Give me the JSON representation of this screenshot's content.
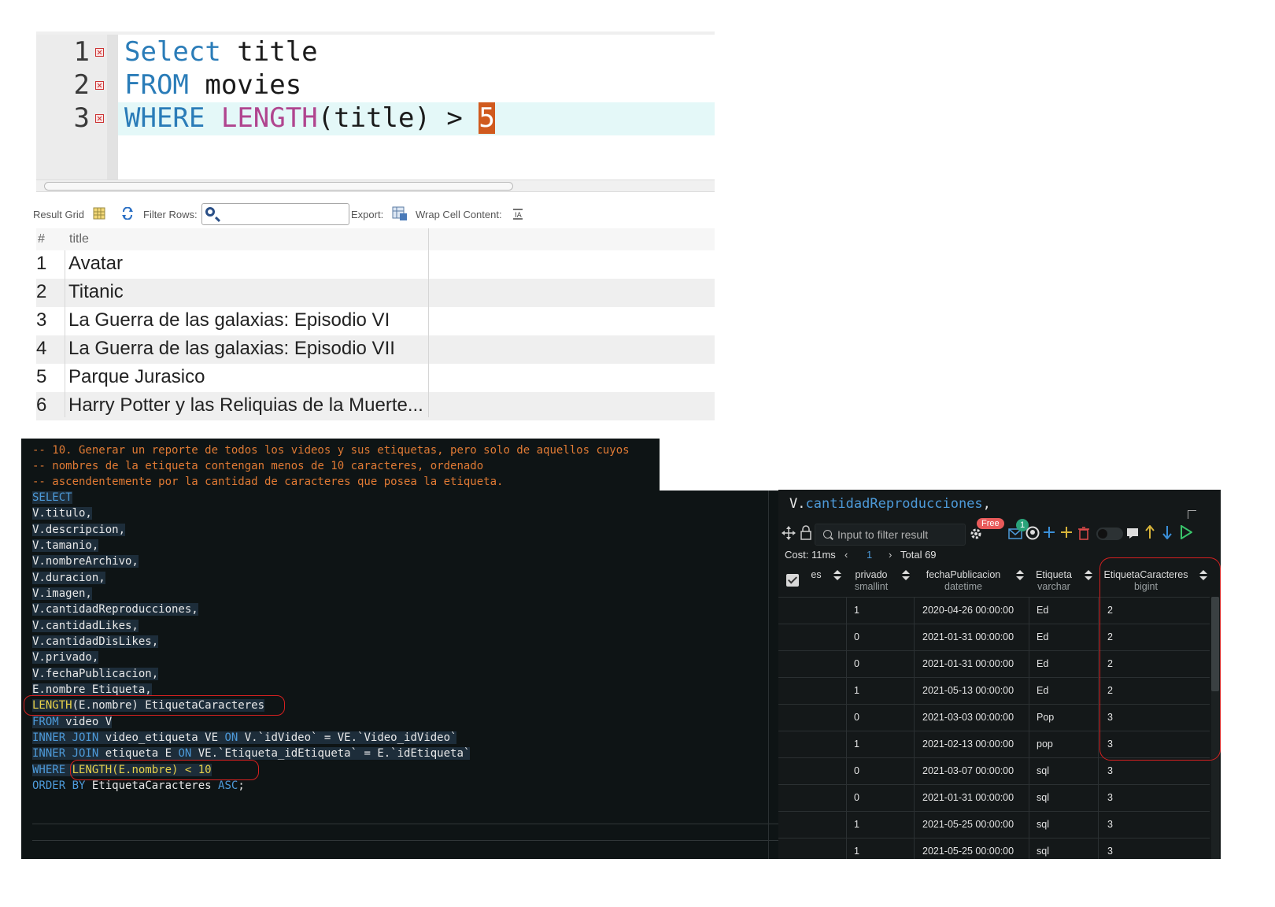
{
  "top_editor": {
    "lines": [
      {
        "num": "1",
        "kw": "Select",
        "rest": " title"
      },
      {
        "num": "2",
        "kw": "FROM",
        "rest": " movies"
      },
      {
        "num": "3",
        "kw": "WHERE",
        "fn": "LENGTH",
        "rest": "(title) > ",
        "cursor_value": "5"
      }
    ]
  },
  "toolbar": {
    "result_grid": "Result Grid",
    "filter_rows": "Filter Rows:",
    "filter_value": "",
    "export": "Export:",
    "wrap": "Wrap Cell Content:"
  },
  "top_grid": {
    "headers": [
      "#",
      "title"
    ],
    "rows": [
      {
        "idx": "1",
        "title": "Avatar"
      },
      {
        "idx": "2",
        "title": "Titanic"
      },
      {
        "idx": "3",
        "title": "La Guerra de las galaxias: Episodio VI"
      },
      {
        "idx": "4",
        "title": "La Guerra de las galaxias: Episodio VII"
      },
      {
        "idx": "5",
        "title": "Parque Jurasico"
      },
      {
        "idx": "6",
        "title": "Harry Potter y las Reliquias de la Muerte..."
      }
    ]
  },
  "sql_editor": {
    "comments": [
      "-- 10. Generar un reporte de todos los videos y sus etiquetas, pero solo de aquellos cuyos",
      "-- nombres de la etiqueta contengan menos de 10 caracteres, ordenado",
      "-- ascendentemente por la cantidad de caracteres que posea la etiqueta."
    ],
    "select_kw": "SELECT",
    "columns": [
      "V.titulo,",
      "V.descripcion,",
      "V.tamanio,",
      "V.nombreArchivo,",
      "V.duracion,",
      "V.imagen,",
      "V.cantidadReproducciones,",
      "V.cantidadLikes,",
      "V.cantidadDisLikes,",
      "V.privado,",
      "V.fechaPublicacion,",
      "E.nombre Etiqueta,"
    ],
    "length_line": {
      "fn": "LENGTH",
      "arg": "(E.nombre)",
      "alias": " EtiquetaCaracteres"
    },
    "from_line": {
      "kw": "FROM",
      "rest": " video V"
    },
    "join1": {
      "kw1": "INNER JOIN",
      "mid": " video_etiqueta VE ",
      "kw2": "ON",
      "rest": " V.`idVideo` = VE.`Video_idVideo`"
    },
    "join2": {
      "kw1": "INNER JOIN",
      "mid": " etiqueta E ",
      "kw2": "ON",
      "rest": " VE.`Etiqueta_idEtiqueta` = E.`idEtiqueta`"
    },
    "where_line": {
      "kw": "WHERE",
      "cond": "LENGTH(E.nombre) < 10"
    },
    "order_line": {
      "kw1": "ORDER BY",
      "mid": " EtiquetaCaracteres ",
      "kw2": "ASC",
      "end": ";"
    }
  },
  "result_panel": {
    "code_echo_obj": "V.",
    "code_echo_prop": "cantidadReproducciones",
    "code_echo_end": ",",
    "filter_placeholder": "Input to filter result",
    "free_badge": "Free",
    "notif_count": "1",
    "cost": "Cost: 11ms",
    "page": "1",
    "total": "Total 69",
    "columns": [
      {
        "name": "es",
        "type": ""
      },
      {
        "name": "privado",
        "type": "smallint"
      },
      {
        "name": "fechaPublicacion",
        "type": "datetime"
      },
      {
        "name": "Etiqueta",
        "type": "varchar"
      },
      {
        "name": "EtiquetaCaracteres",
        "type": "bigint"
      }
    ],
    "rows": [
      {
        "privado": "1",
        "fecha": "2020-04-26 00:00:00",
        "etiqueta": "Ed",
        "chars": "2"
      },
      {
        "privado": "0",
        "fecha": "2021-01-31 00:00:00",
        "etiqueta": "Ed",
        "chars": "2"
      },
      {
        "privado": "0",
        "fecha": "2021-01-31 00:00:00",
        "etiqueta": "Ed",
        "chars": "2"
      },
      {
        "privado": "1",
        "fecha": "2021-05-13 00:00:00",
        "etiqueta": "Ed",
        "chars": "2"
      },
      {
        "privado": "0",
        "fecha": "2021-03-03 00:00:00",
        "etiqueta": "Pop",
        "chars": "3"
      },
      {
        "privado": "1",
        "fecha": "2021-02-13 00:00:00",
        "etiqueta": "pop",
        "chars": "3"
      },
      {
        "privado": "0",
        "fecha": "2021-03-07 00:00:00",
        "etiqueta": "sql",
        "chars": "3"
      },
      {
        "privado": "0",
        "fecha": "2021-01-31 00:00:00",
        "etiqueta": "sql",
        "chars": "3"
      },
      {
        "privado": "1",
        "fecha": "2021-05-25 00:00:00",
        "etiqueta": "sql",
        "chars": "3"
      },
      {
        "privado": "1",
        "fecha": "2021-05-25 00:00:00",
        "etiqueta": "sql",
        "chars": "3"
      }
    ]
  },
  "colors": {
    "keyword_blue": "#2a7cb8",
    "comment_orange": "#e07a34",
    "highlight_red": "#d42020",
    "cursor_orange": "#d05a1e"
  }
}
